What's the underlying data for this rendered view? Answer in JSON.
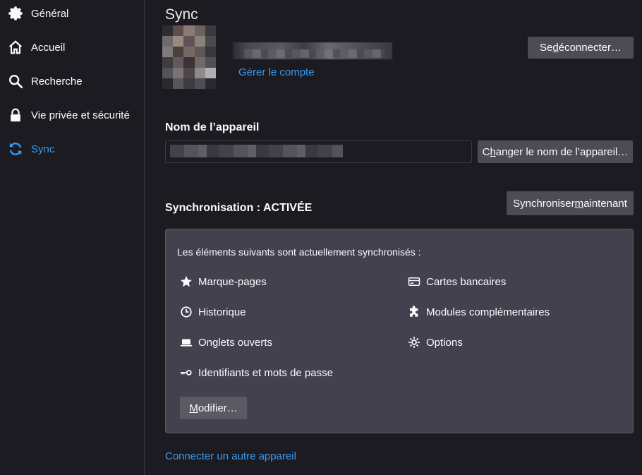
{
  "sidebar": {
    "items": [
      {
        "label": "Général",
        "icon": "gear-icon"
      },
      {
        "label": "Accueil",
        "icon": "home-icon"
      },
      {
        "label": "Recherche",
        "icon": "search-icon"
      },
      {
        "label": "Vie privée et sécurité",
        "icon": "lock-icon"
      },
      {
        "label": "Sync",
        "icon": "sync-icon",
        "active": true
      }
    ]
  },
  "sync_page": {
    "title": "Sync",
    "manage_account": "Gérer le compte",
    "logout_button": {
      "pre": "Se ",
      "accesskey": "d",
      "post": "éconnecter…"
    },
    "device_name_label": "Nom de l’appareil",
    "rename_button": {
      "pre": "C",
      "accesskey": "h",
      "post": "anger le nom de l’appareil…"
    },
    "sync_status": "Synchronisation : ACTIVÉE",
    "sync_now_button": {
      "pre": "Synchroniser ",
      "accesskey": "m",
      "post": "aintenant"
    },
    "sync_intro": "Les éléments suivants sont actuellement synchronisés :",
    "items_left": [
      {
        "label": "Marque-pages",
        "icon": "star-icon"
      },
      {
        "label": "Historique",
        "icon": "clock-icon"
      },
      {
        "label": "Onglets ouverts",
        "icon": "laptop-icon"
      },
      {
        "label": "Identifiants et mots de passe",
        "icon": "key-icon"
      }
    ],
    "items_right": [
      {
        "label": "Cartes bancaires",
        "icon": "credit-card-icon"
      },
      {
        "label": "Modules complémentaires",
        "icon": "puzzle-icon"
      },
      {
        "label": "Options",
        "icon": "gear-icon"
      }
    ],
    "modify_button": {
      "pre": "",
      "accesskey": "M",
      "post": "odifier…"
    },
    "connect_device": "Connecter un autre appareil"
  },
  "colors": {
    "accent": "#3a9bf0",
    "background": "#1c1b22",
    "button": "#4d4c55",
    "panel": "#42414d"
  }
}
